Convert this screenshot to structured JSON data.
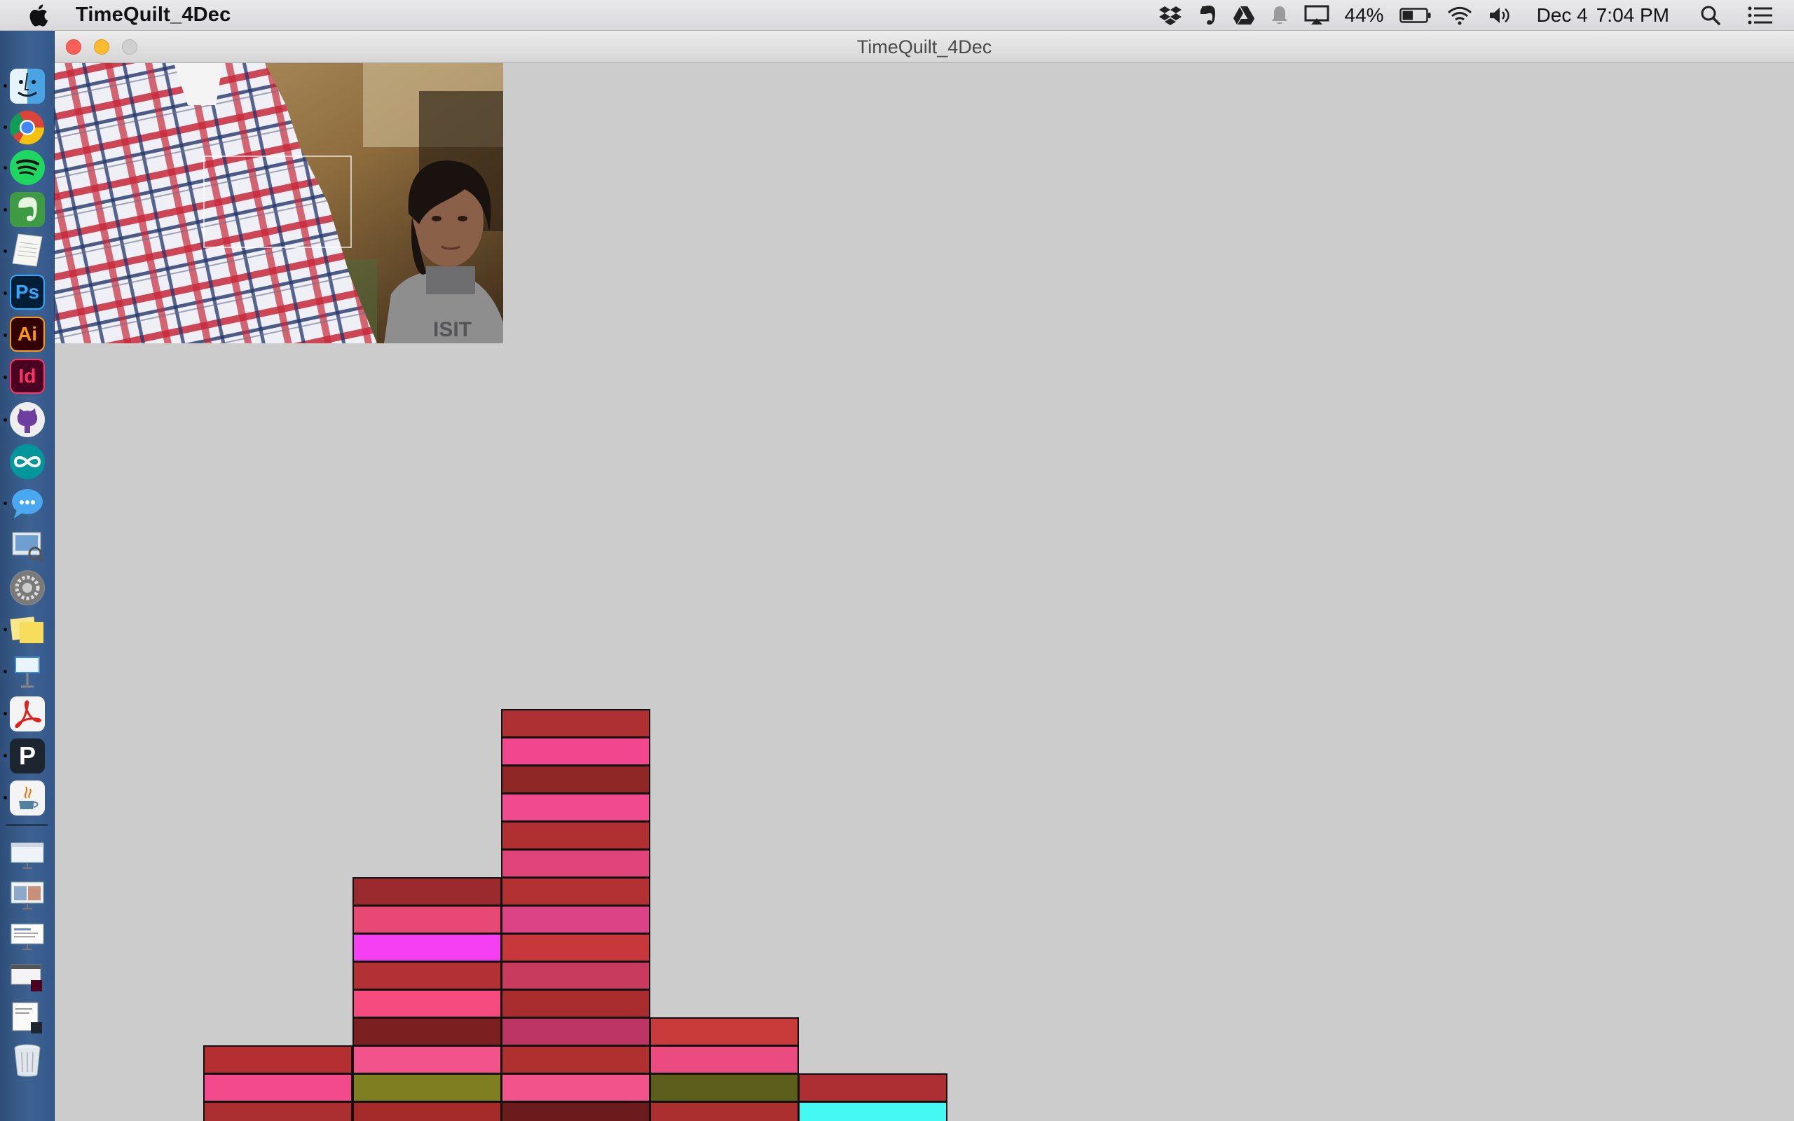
{
  "menubar": {
    "app_name": "TimeQuilt_4Dec",
    "battery_percent": "44%",
    "date": "Dec 4",
    "time": "7:04 PM",
    "icons": [
      "apple-icon",
      "dropbox-icon",
      "evernote-icon",
      "google-drive-icon",
      "notification-bell-icon",
      "airplay-icon",
      "battery-icon",
      "wifi-icon",
      "volume-icon",
      "spotlight-search-icon",
      "notification-center-icon"
    ]
  },
  "window": {
    "title": "TimeQuilt_4Dec"
  },
  "dock": {
    "apps": [
      {
        "name": "finder",
        "running": true
      },
      {
        "name": "chrome",
        "running": true
      },
      {
        "name": "spotify",
        "running": true
      },
      {
        "name": "evernote",
        "running": true
      },
      {
        "name": "textedit",
        "running": true
      },
      {
        "name": "photoshop",
        "label": "Ps",
        "running": true
      },
      {
        "name": "illustrator",
        "label": "Ai",
        "running": true
      },
      {
        "name": "indesign",
        "label": "Id",
        "running": true
      },
      {
        "name": "github",
        "running": true
      },
      {
        "name": "arduino",
        "running": false
      },
      {
        "name": "messages",
        "running": true
      },
      {
        "name": "preview",
        "running": false
      },
      {
        "name": "system-preferences",
        "running": false
      },
      {
        "name": "stickies",
        "running": true
      },
      {
        "name": "keynote",
        "running": true
      },
      {
        "name": "acrobat",
        "running": true
      },
      {
        "name": "processing",
        "label": "P",
        "running": true
      },
      {
        "name": "java",
        "running": true
      },
      {
        "name": "minimized-window-1",
        "running": false
      },
      {
        "name": "minimized-window-2",
        "running": false
      },
      {
        "name": "minimized-window-3",
        "running": false
      },
      {
        "name": "minimized-window-indesign",
        "running": false
      },
      {
        "name": "minimized-window-processing",
        "running": false
      },
      {
        "name": "trash",
        "running": false
      }
    ]
  },
  "quilt": {
    "colors_note": "columns listed left to right, cells listed bottom to top",
    "columns": [
      [
        "#ab2f30",
        "#f24a8a",
        "#b52f32"
      ],
      [
        "#a52b2b",
        "#7f7f22",
        "#f2538a",
        "#7b1f21",
        "#f54b7e",
        "#b33034",
        "#f43ff2",
        "#e84874",
        "#9a2a2d"
      ],
      [
        "#6b1b1c",
        "#f2538a",
        "#b03030",
        "#bc3565",
        "#a92c2e",
        "#c93a5f",
        "#c8373a",
        "#db4386",
        "#b33033",
        "#e1447b",
        "#b02f31",
        "#f24a8f",
        "#902727",
        "#f2478e",
        "#ae3032"
      ],
      [
        "#ac2f30",
        "#5c5f1c",
        "#ec4b82",
        "#c93b3b"
      ],
      [
        "#46f8f3",
        "#ad2f33"
      ]
    ]
  },
  "colors": {
    "background": "#cccccc",
    "dock": "#3d6292",
    "close": "#fc5f57",
    "minimize": "#fdbc2e"
  }
}
